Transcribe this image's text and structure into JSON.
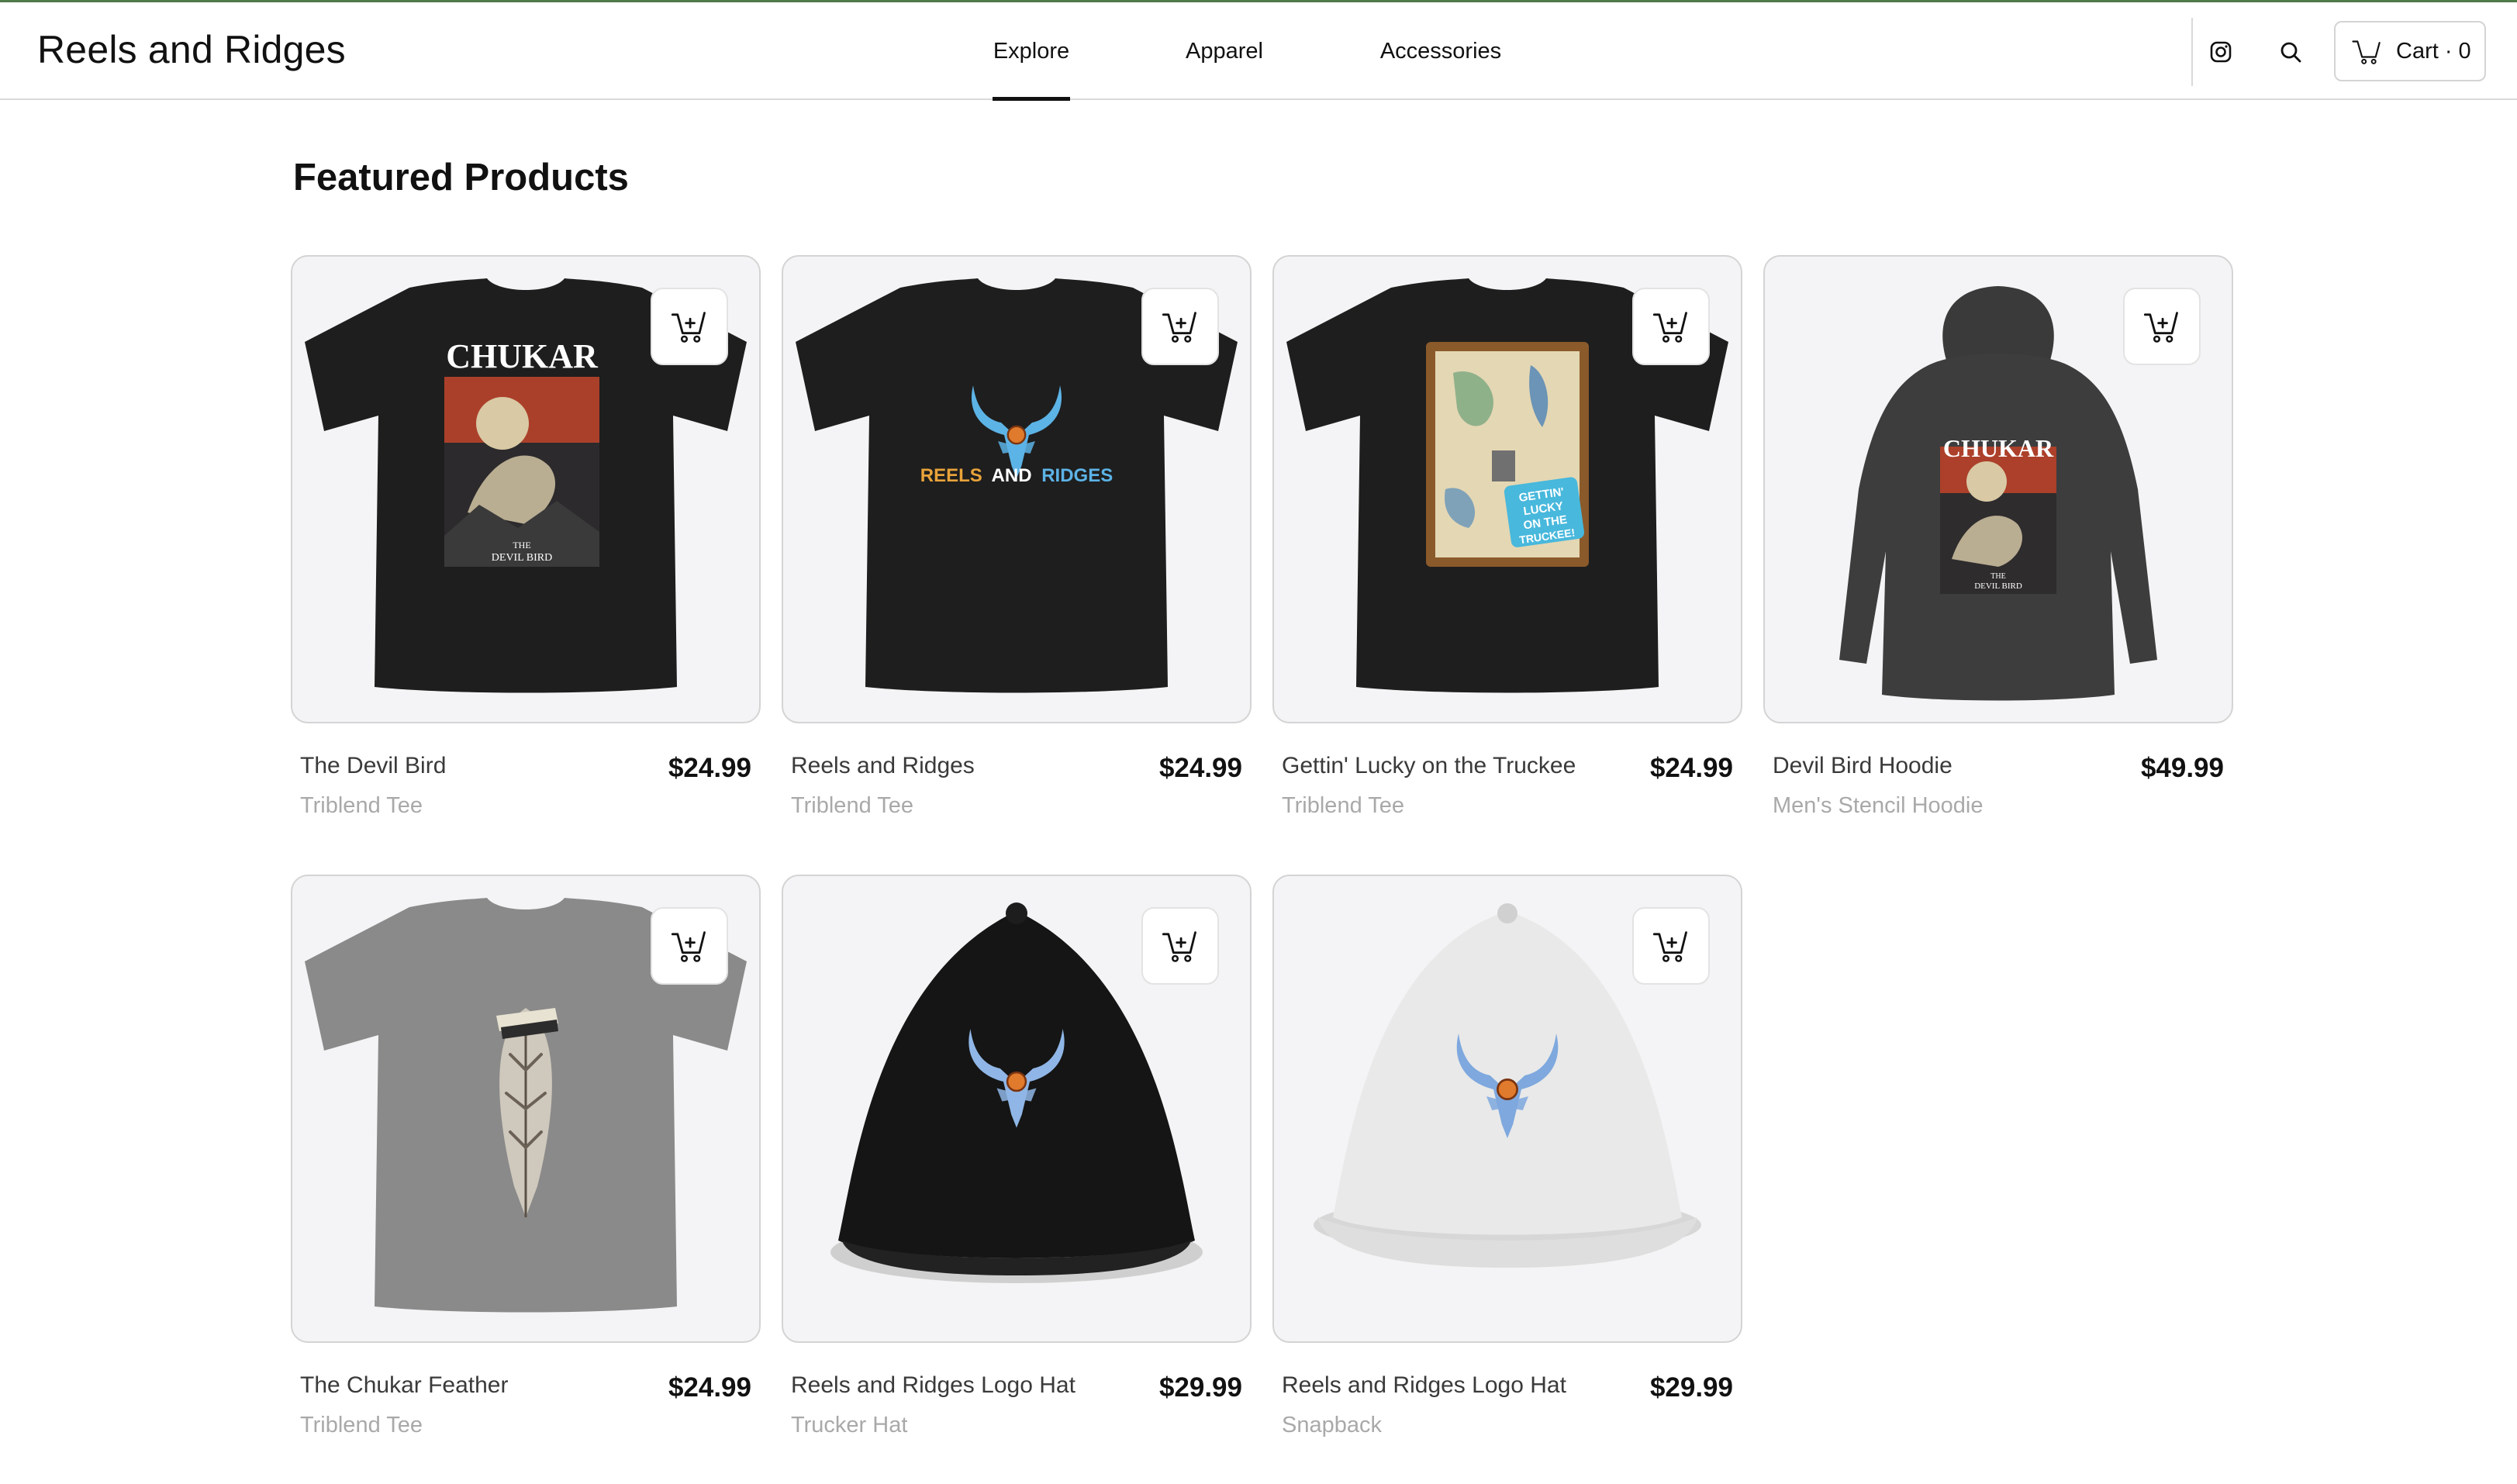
{
  "header": {
    "brand": "Reels and Ridges",
    "nav": [
      {
        "label": "Explore",
        "active": true
      },
      {
        "label": "Apparel",
        "active": false
      },
      {
        "label": "Accessories",
        "active": false
      }
    ],
    "icons": [
      "instagram-icon",
      "search-icon"
    ],
    "cart_label": "Cart · 0"
  },
  "main": {
    "section_title": "Featured Products",
    "products": [
      {
        "name": "The Devil Bird",
        "price": "$24.99",
        "variant": "Triblend Tee",
        "image": "black-tshirt-chukar"
      },
      {
        "name": "Reels and Ridges",
        "price": "$24.99",
        "variant": "Triblend Tee",
        "image": "black-tshirt-logo"
      },
      {
        "name": "Gettin' Lucky on the Truckee",
        "price": "$24.99",
        "variant": "Triblend Tee",
        "image": "black-tshirt-map"
      },
      {
        "name": "Devil Bird Hoodie",
        "price": "$49.99",
        "variant": "Men's Stencil Hoodie",
        "image": "charcoal-hoodie-chukar"
      },
      {
        "name": "The Chukar Feather",
        "price": "$24.99",
        "variant": "Triblend Tee",
        "image": "grey-tshirt-feather"
      },
      {
        "name": "Reels and Ridges Logo Hat",
        "price": "$29.99",
        "variant": "Trucker Hat",
        "image": "black-cap-logo"
      },
      {
        "name": "Reels and Ridges Logo Hat",
        "price": "$29.99",
        "variant": "Snapback",
        "image": "white-cap-logo"
      }
    ]
  },
  "artwork_text": {
    "chukar": "CHUKAR",
    "devil_bird_1": "THE",
    "devil_bird_2": "DEVIL BIRD",
    "logo_reels": "REELS",
    "logo_and": "AND",
    "logo_ridges": "RIDGES",
    "truckee_1": "GETTIN'",
    "truckee_2": "LUCKY",
    "truckee_3": "ON THE",
    "truckee_4": "TRUCKEE!"
  },
  "colors": {
    "accent_line": "#4f7a4a",
    "card_bg": "#f4f4f6",
    "border": "#d4d4d4",
    "logo_blue": "#5cb3e6",
    "logo_orange": "#e8a33a"
  }
}
